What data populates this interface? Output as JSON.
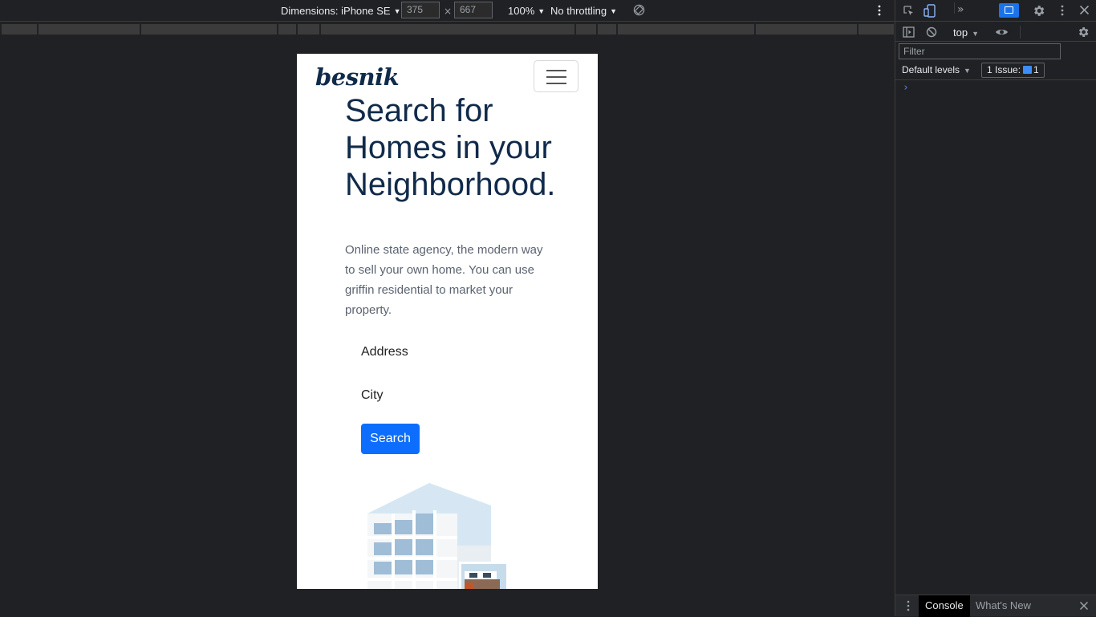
{
  "emulation_toolbar": {
    "dimensions_label": "Dimensions: iPhone SE",
    "width_value": "375",
    "times_sign": "×",
    "height_value": "667",
    "zoom_label": "100%",
    "throttling_label": "No throttling"
  },
  "page": {
    "brand": "besnik",
    "hero_title": "Search for Homes in your Neighborhood.",
    "hero_text": "Online state agency, the modern way to sell your own home. You can use griffin residential to market your property.",
    "address_label": "Address",
    "city_label": "City",
    "search_button": "Search",
    "colors": {
      "brand": "#102a4a",
      "button": "#0d6efd",
      "title": "#102a4a",
      "text": "#5b6370"
    }
  },
  "devtools": {
    "context": "top",
    "filter_placeholder": "Filter",
    "levels_label": "Default levels",
    "issues_label": "1 Issue:",
    "issues_count": "1",
    "prompt_symbol": "›",
    "drawer_tabs": {
      "console": "Console",
      "whats_new": "What's New"
    },
    "icons": [
      "inspect-icon",
      "device-toggle-icon",
      "more-tabs-icon",
      "issues-badge-icon",
      "settings-icon",
      "kebab-menu-icon",
      "close-icon",
      "sidebar-toggle-icon",
      "clear-console-icon",
      "live-expression-icon",
      "console-settings-icon"
    ]
  }
}
